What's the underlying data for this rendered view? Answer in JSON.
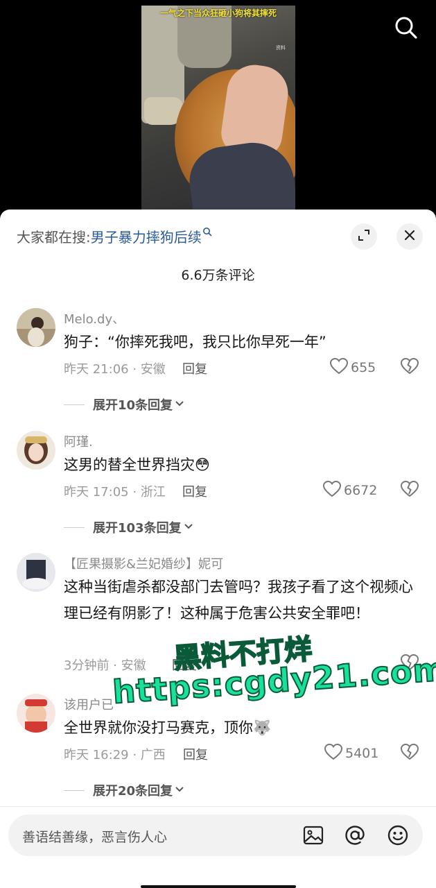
{
  "video": {
    "caption": "一气之下当众狂砸小狗将其摔死",
    "mark": "资料",
    "search_icon": "search-icon"
  },
  "sheet": {
    "hot_search_label": "大家都在搜:",
    "hot_search_term": "男子暴力摔狗后续",
    "comment_count": "6.6万条评论"
  },
  "comments": [
    {
      "username": "Melo.dy、",
      "text": "狗子：“你摔死我吧，我只比你早死一年”",
      "time_location": "昨天 21:06 · 安徽",
      "reply_label": "回复",
      "likes": "655",
      "expand_label": "展开10条回复"
    },
    {
      "username": "阿瑾.",
      "text": "这男的替全世界挡灾",
      "emoji": "😳",
      "time_location": "昨天 17:05 · 浙江",
      "reply_label": "回复",
      "likes": "6672",
      "expand_label": "展开103条回复"
    },
    {
      "username": "【匠果摄影&兰妃婚纱】妮可",
      "text": "这种当街虐杀都没部门去管吗？我孩子看了这个视频心理已经有阴影了！这种属于危害公共安全罪吧！",
      "time_location": "3分钟前 · 安徽",
      "reply_label": "回复",
      "likes": ""
    },
    {
      "username": "该用户已",
      "text": "全世界就你没打马赛克，顶你",
      "emoji": "🐺",
      "time_location": "昨天 16:29 · 广西",
      "reply_label": "回复",
      "likes": "5401",
      "expand_label": "展开20条回复"
    }
  ],
  "watermark": {
    "line1": "黑料不打烊",
    "line2": "https:cgdy21.com"
  },
  "input": {
    "placeholder": "善语结善缘，恶言伤人心",
    "icons": [
      "image-icon",
      "at-icon",
      "emoji-icon"
    ]
  },
  "colors": {
    "link_blue": "#2a5a9a",
    "watermark_green": "#19e09a"
  }
}
